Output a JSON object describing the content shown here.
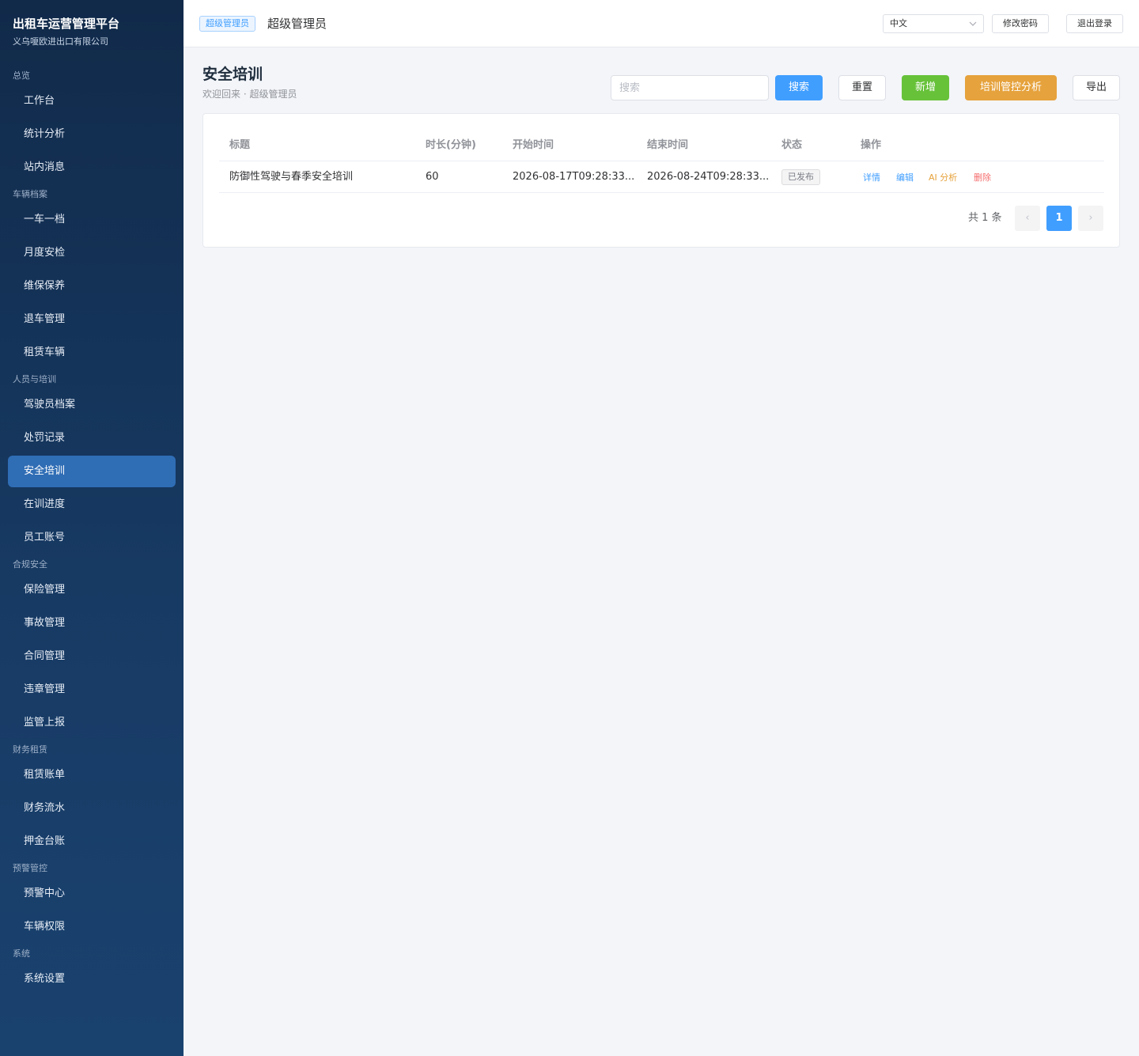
{
  "sidebar": {
    "title": "出租车运营管理平台",
    "company": "义乌嗄欧进出口有限公司",
    "groups": [
      {
        "title": "总览",
        "items": [
          "工作台",
          "统计分析",
          "站内消息"
        ]
      },
      {
        "title": "车辆档案",
        "items": [
          "一车一档",
          "月度安检",
          "维保保养",
          "退车管理",
          "租赁车辆"
        ]
      },
      {
        "title": "人员与培训",
        "items": [
          "驾驶员档案",
          "处罚记录",
          "安全培训",
          "在训进度",
          "员工账号"
        ]
      },
      {
        "title": "合规安全",
        "items": [
          "保险管理",
          "事故管理",
          "合同管理",
          "违章管理",
          "监管上报"
        ]
      },
      {
        "title": "财务租赁",
        "items": [
          "租赁账单",
          "财务流水",
          "押金台账"
        ]
      },
      {
        "title": "预警管控",
        "items": [
          "预警中心",
          "车辆权限"
        ]
      },
      {
        "title": "系统",
        "items": [
          "系统设置"
        ]
      }
    ],
    "active_item": "安全培训"
  },
  "header": {
    "role_badge": "超级管理员",
    "role_name": "超级管理员",
    "language": "中文",
    "change_password": "修改密码",
    "logout": "退出登录"
  },
  "page": {
    "title": "安全培训",
    "subtitle": "欢迎回来 · 超级管理员"
  },
  "toolbar": {
    "search_placeholder": "搜索",
    "search": "搜索",
    "reset": "重置",
    "add": "新增",
    "analysis": "培训管控分析",
    "export": "导出"
  },
  "table": {
    "columns": [
      "标题",
      "时长(分钟)",
      "开始时间",
      "结束时间",
      "状态",
      "操作"
    ],
    "rows": [
      {
        "title": "防御性驾驶与春季安全培训",
        "duration": "60",
        "start": "2026-08-17T09:28:33...",
        "end": "2026-08-24T09:28:33...",
        "status": "已发布",
        "actions": [
          "详情",
          "编辑",
          "AI 分析",
          "删除"
        ]
      }
    ]
  },
  "pagination": {
    "total_text": "共 1 条",
    "prev": "‹",
    "current": "1",
    "next": "›"
  },
  "colors": {
    "primary": "#409eff",
    "success": "#67c23a",
    "warning": "#e6a23c",
    "danger": "#f56c6c",
    "sidebar_active": "#2f6db5"
  }
}
